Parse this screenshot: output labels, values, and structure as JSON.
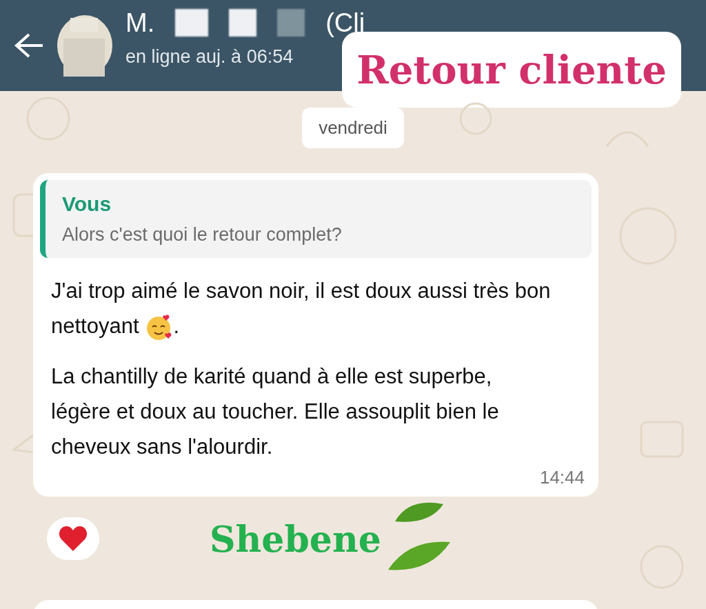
{
  "header": {
    "name": "M.",
    "name_suffix": "(Cli",
    "status": "en ligne auj. à 06:54"
  },
  "overlay_badge": {
    "text": "Retour cliente"
  },
  "date_chip": "vendredi",
  "message": {
    "quote": {
      "author": "Vous",
      "text": "Alors c'est quoi le retour complet?"
    },
    "paragraphs": [
      {
        "kind": "with_emoji",
        "text": "J'ai trop aimé le savon noir, il est doux aussi très bon nettoyant",
        "tail": "."
      },
      {
        "kind": "plain",
        "text": "La chantilly de karité quand à elle est superbe, légère et doux au toucher. Elle assouplit bien le cheveux sans l'alourdir."
      }
    ],
    "time": "14:44"
  },
  "brand": {
    "text": "Shebene"
  }
}
